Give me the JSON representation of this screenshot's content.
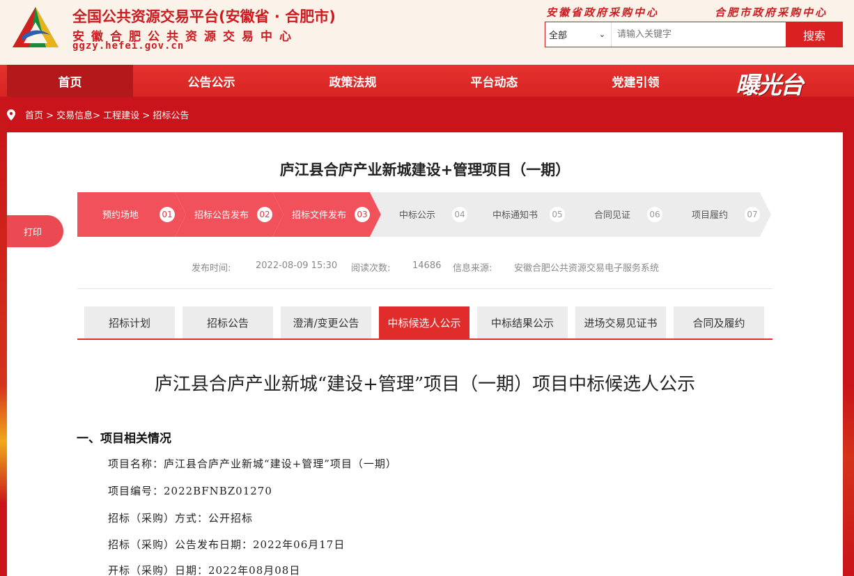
{
  "header": {
    "title": "全国公共资源交易平台(安徽省 · 合肥市)",
    "subtitle": "安徽合肥公共资源交易中心",
    "url": "ggzy.hefei.gov.cn",
    "link_province": "安徽省政府采购中心",
    "link_city": "合肥市政府采购中心"
  },
  "search": {
    "select_value": "全部",
    "placeholder": "请输入关键字",
    "button": "搜索"
  },
  "nav": {
    "items": [
      "首页",
      "公告公示",
      "政策法规",
      "平台动态",
      "党建引领"
    ],
    "brand": "曝光台"
  },
  "breadcrumb": "首页 > 交易信息> 工程建设 > 招标公告",
  "print_label": "打印",
  "project_title": "庐江县合庐产业新城建设+管理项目（一期）",
  "steps": [
    {
      "label": "预约场地",
      "num": "01",
      "done": true
    },
    {
      "label": "招标公告发布",
      "num": "02",
      "done": true
    },
    {
      "label": "招标文件发布",
      "num": "03",
      "done": true
    },
    {
      "label": "中标公示",
      "num": "04",
      "done": false
    },
    {
      "label": "中标通知书",
      "num": "05",
      "done": false
    },
    {
      "label": "合同见证",
      "num": "06",
      "done": false
    },
    {
      "label": "项目履约",
      "num": "07",
      "done": false
    }
  ],
  "meta": {
    "publish_label": "发布时间:",
    "publish_value": "2022-08-09 15:30",
    "reads_label": "阅读次数:",
    "reads_value": "14686",
    "source_label": "信息来源:",
    "source_value": "安徽合肥公共资源交易电子服务系统"
  },
  "tabs": [
    "招标计划",
    "招标公告",
    "澄清/变更公告",
    "中标候选人公示",
    "中标结果公示",
    "进场交易见证书",
    "合同及履约"
  ],
  "active_tab": "中标候选人公示",
  "document": {
    "title": "庐江县合庐产业新城“建设+管理”项目（一期）项目中标候选人公示",
    "section1": "一、项目相关情况",
    "lines": [
      "项目名称：庐江县合庐产业新城“建设+管理”项目（一期）",
      "项目编号：2022BFNBZ01270",
      "招标（采购）方式：公开招标",
      "招标（采购）公告发布日期：2022年06月17日",
      "开标（采购）日期：2022年08月08日"
    ]
  },
  "colors": {
    "brand_red": "#d92121",
    "step_done": "#f1515a",
    "tab_active": "#e02d2b"
  }
}
